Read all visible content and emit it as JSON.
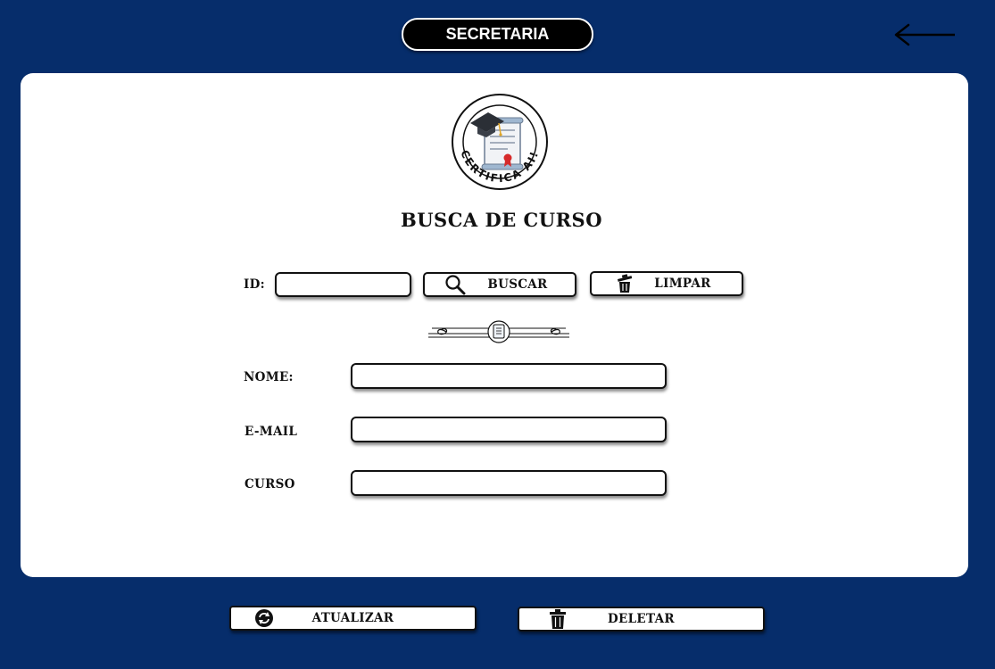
{
  "header": {
    "title": "SECRETARIA"
  },
  "logo": {
    "text": "CERTIFICA AI!"
  },
  "page_title": "BUSCA DE CURSO",
  "search": {
    "id_label": "ID:",
    "id_value": "",
    "search_button": "BUSCAR",
    "clear_button": "LIMPAR"
  },
  "form": {
    "fields": [
      {
        "label": "NOME:",
        "value": ""
      },
      {
        "label": "E-MAIL",
        "value": ""
      },
      {
        "label": "CURSO",
        "value": ""
      }
    ]
  },
  "actions": {
    "update_button": "ATUALIZAR",
    "delete_button": "DELETAR"
  },
  "colors": {
    "background": "#062d6b",
    "card": "#ffffff",
    "accent": "#000000"
  }
}
